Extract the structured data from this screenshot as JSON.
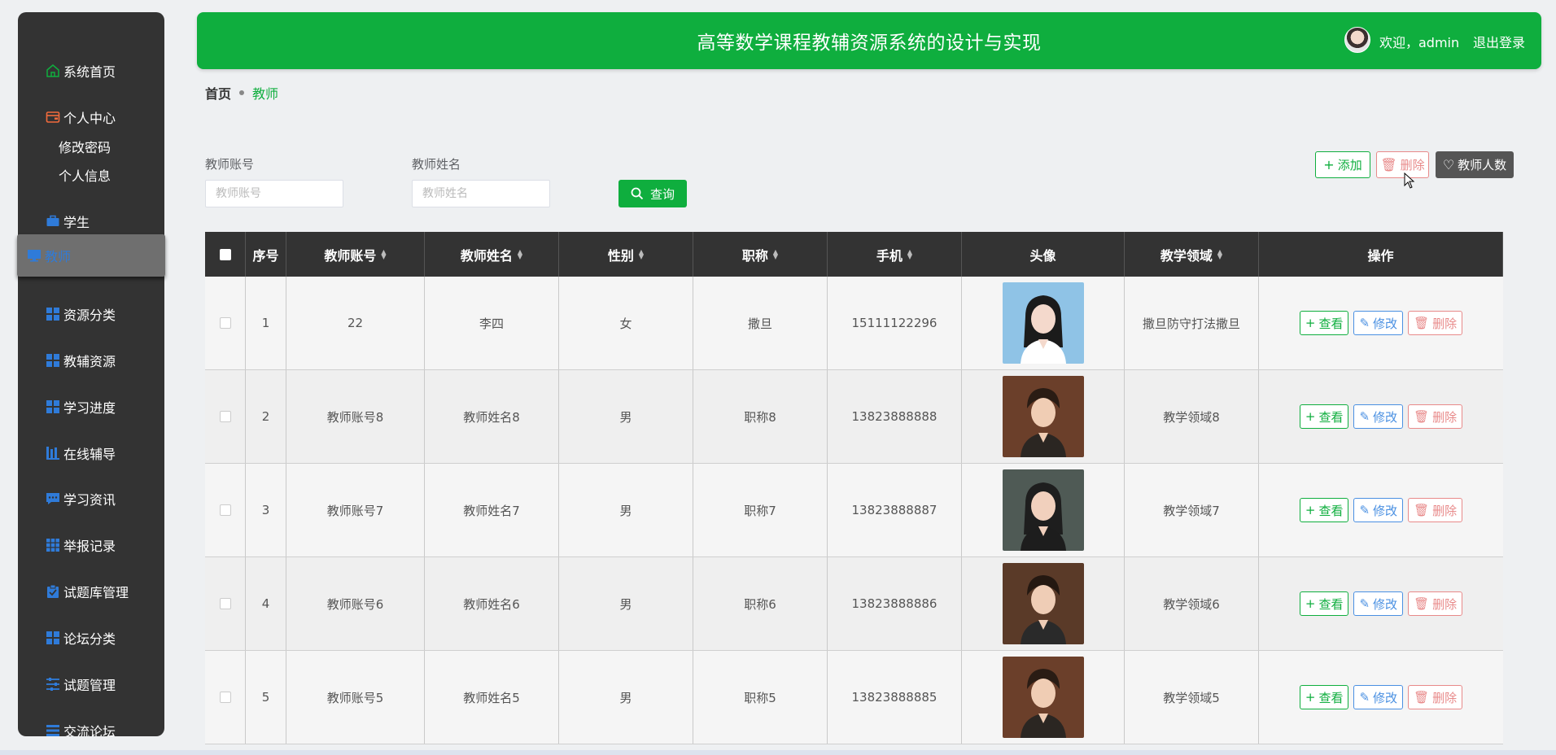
{
  "sidebar": {
    "items": [
      {
        "label": "系统首页",
        "icon": "home-icon"
      },
      {
        "label": "个人中心",
        "icon": "wallet-icon"
      },
      {
        "label": "修改密码"
      },
      {
        "label": "个人信息"
      },
      {
        "label": "学生",
        "icon": "briefcase-icon"
      },
      {
        "label": "教师",
        "icon": "monitor-icon"
      },
      {
        "label": "资源分类",
        "icon": "grid-icon"
      },
      {
        "label": "教辅资源",
        "icon": "grid-icon"
      },
      {
        "label": "学习进度",
        "icon": "grid-icon"
      },
      {
        "label": "在线辅导",
        "icon": "chart-icon"
      },
      {
        "label": "学习资讯",
        "icon": "chat-icon"
      },
      {
        "label": "举报记录",
        "icon": "grid9-icon"
      },
      {
        "label": "试题库管理",
        "icon": "clipboard-icon"
      },
      {
        "label": "论坛分类",
        "icon": "grid-icon"
      },
      {
        "label": "试题管理",
        "icon": "sliders-icon"
      },
      {
        "label": "交流论坛",
        "icon": "list-icon"
      }
    ]
  },
  "header": {
    "title": "高等数学课程教辅资源系统的设计与实现",
    "welcome": "欢迎，admin",
    "logout": "退出登录"
  },
  "breadcrumb": {
    "home": "首页",
    "current": "教师"
  },
  "search": {
    "account_label": "教师账号",
    "account_placeholder": "教师账号",
    "name_label": "教师姓名",
    "name_placeholder": "教师姓名",
    "button": "查询"
  },
  "actions": {
    "add": "添加",
    "delete": "删除",
    "count": "教师人数"
  },
  "table": {
    "headers": [
      "序号",
      "教师账号",
      "教师姓名",
      "性别",
      "职称",
      "手机",
      "头像",
      "教学领域",
      "操作"
    ],
    "rows": [
      {
        "index": "1",
        "account": "22",
        "name": "李四",
        "gender": "女",
        "title": "撒旦",
        "phone": "15111122296",
        "field": "撒旦防守打法撒旦"
      },
      {
        "index": "2",
        "account": "教师账号8",
        "name": "教师姓名8",
        "gender": "男",
        "title": "职称8",
        "phone": "13823888888",
        "field": "教学领域8"
      },
      {
        "index": "3",
        "account": "教师账号7",
        "name": "教师姓名7",
        "gender": "男",
        "title": "职称7",
        "phone": "13823888887",
        "field": "教学领域7"
      },
      {
        "index": "4",
        "account": "教师账号6",
        "name": "教师姓名6",
        "gender": "男",
        "title": "职称6",
        "phone": "13823888886",
        "field": "教学领域6"
      },
      {
        "index": "5",
        "account": "教师账号5",
        "name": "教师姓名5",
        "gender": "男",
        "title": "职称5",
        "phone": "13823888885",
        "field": "教学领域5"
      }
    ],
    "row_actions": {
      "view": "查看",
      "edit": "修改",
      "delete": "删除"
    }
  },
  "colors": {
    "primary": "#0fae3e",
    "sidebar": "#333333",
    "edit": "#4a90e2",
    "danger": "#e88a8a"
  }
}
